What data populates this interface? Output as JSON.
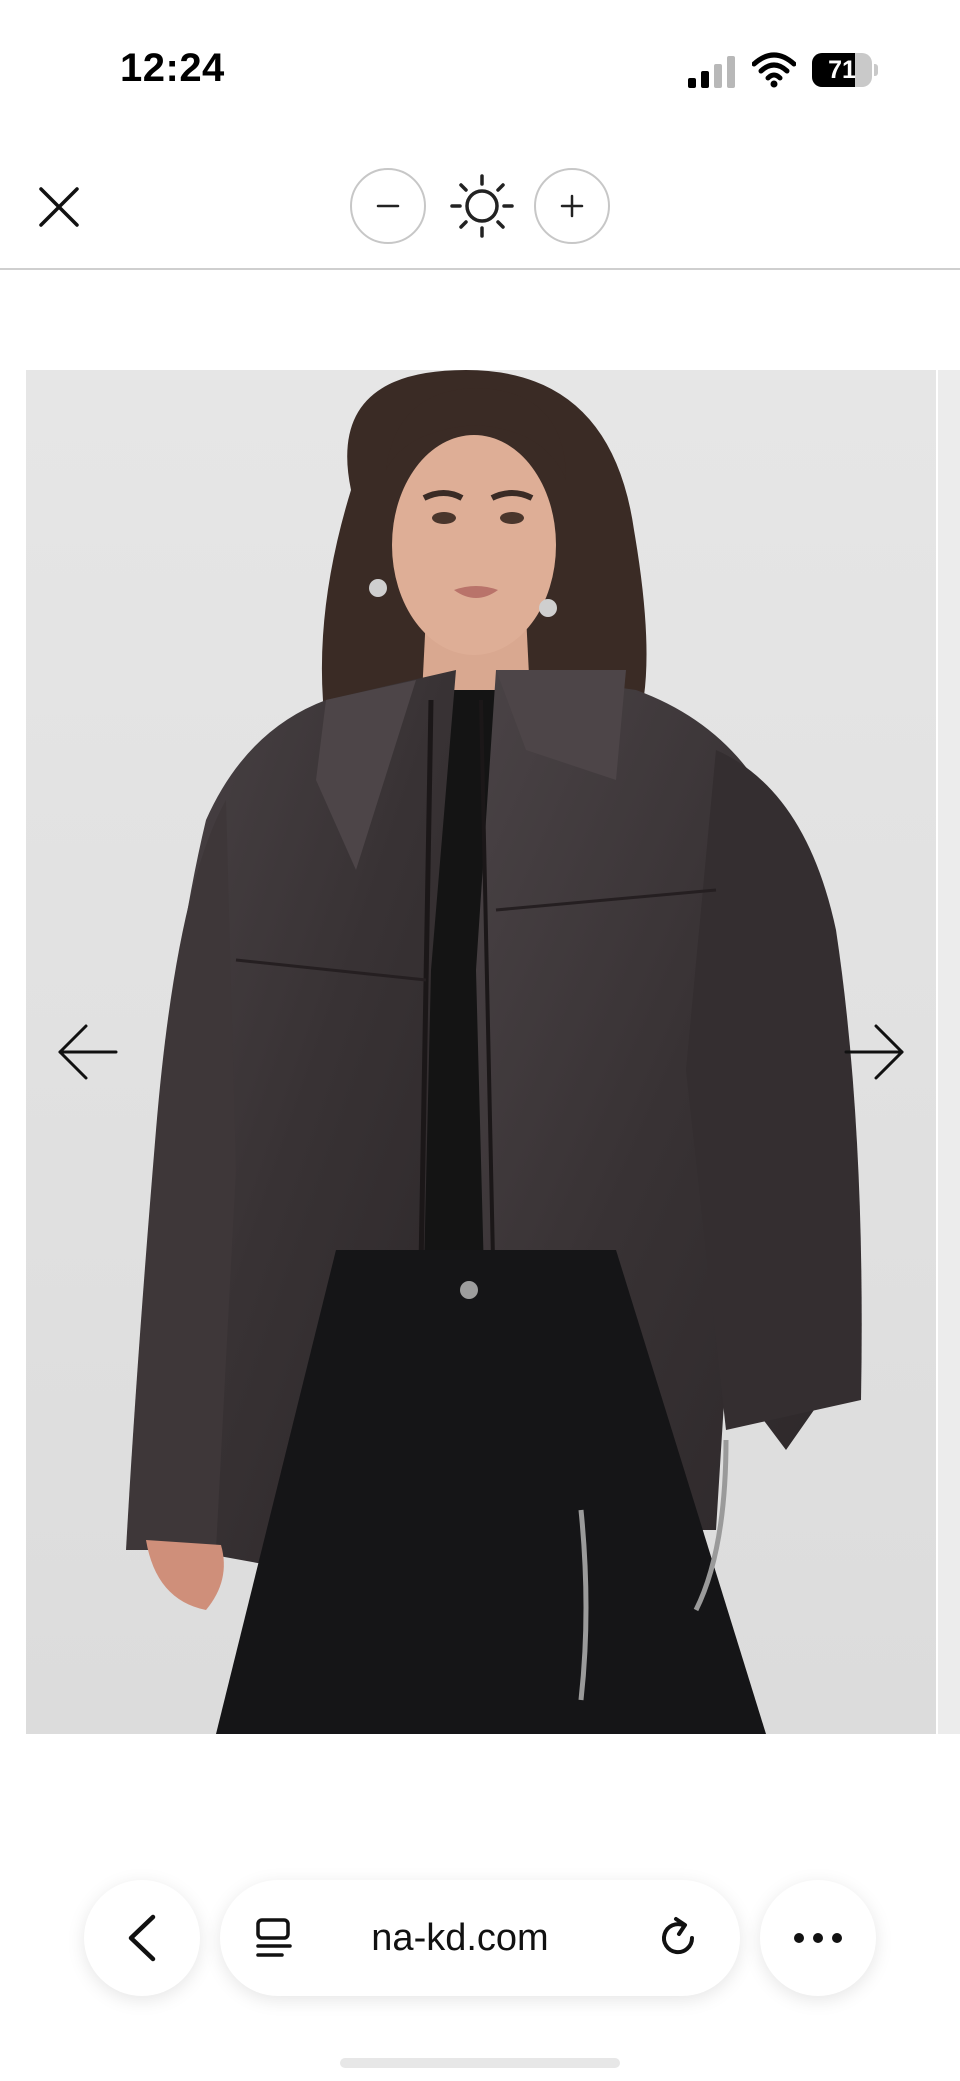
{
  "status_bar": {
    "time": "12:24",
    "battery_level": "71",
    "signal_icon": "cellular-signal-icon",
    "wifi_icon": "wifi-icon"
  },
  "zoom_toolbar": {
    "close_icon": "close-icon",
    "zoom_out_icon": "minus-icon",
    "brightness_icon": "sun-icon",
    "zoom_in_icon": "plus-icon"
  },
  "viewer": {
    "image_description_icon": "product-photo-leather-jacket",
    "prev_icon": "arrow-left-icon",
    "next_icon": "arrow-right-icon"
  },
  "browser_bar": {
    "back_icon": "chevron-left-icon",
    "tabs_icon": "tab-list-icon",
    "url": "na-kd.com",
    "reload_icon": "reload-icon",
    "more_icon": "more-icon"
  },
  "colors": {
    "background": "#ffffff",
    "photo_background": "#e2e2e2",
    "jacket": "#3b3537",
    "divider": "#cfcfcf"
  }
}
